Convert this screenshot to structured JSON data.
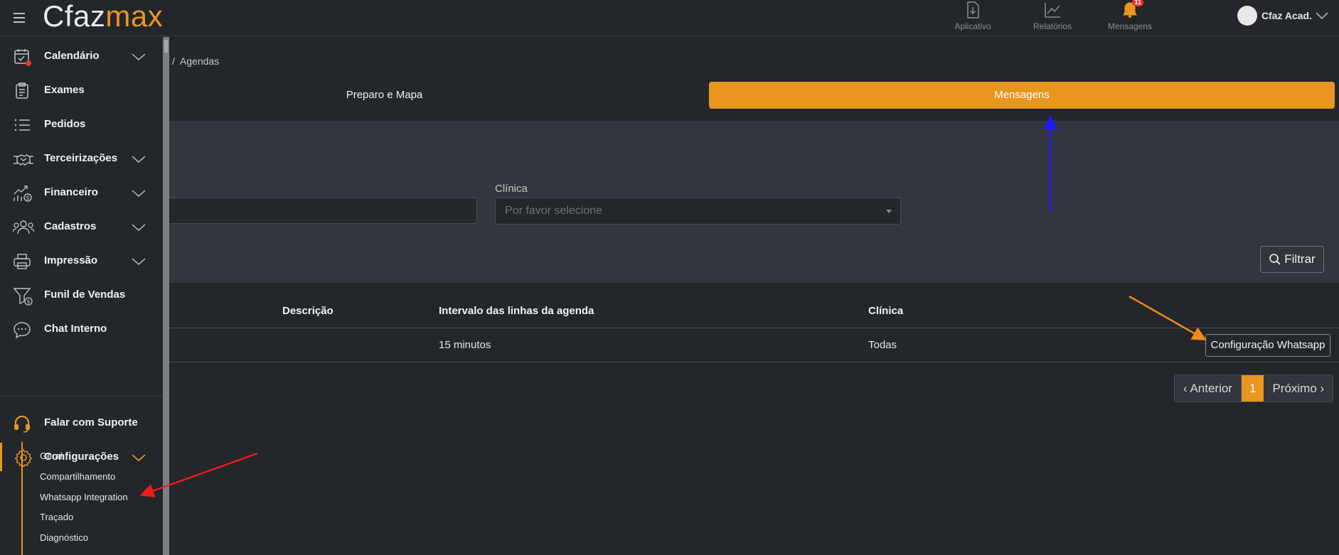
{
  "app": {
    "logo_main": "Cfaz",
    "logo_accent": "max",
    "accent_color": "#e8961f"
  },
  "topnav": [
    {
      "label": "Aplicativo",
      "icon": "download-file-icon"
    },
    {
      "label": "Relatórios",
      "icon": "chart-line-icon"
    },
    {
      "label": "Mensagens",
      "icon": "bell-icon",
      "badge": "11"
    }
  ],
  "user": {
    "name": "Cfaz Acad."
  },
  "sidebar": {
    "items": [
      {
        "label": "Calendário"
      },
      {
        "label": "Exames"
      },
      {
        "label": "Pedidos"
      },
      {
        "label": "Terceirizações"
      },
      {
        "label": "Financeiro"
      },
      {
        "label": "Cadastros"
      },
      {
        "label": "Impressão"
      },
      {
        "label": "Funil de Vendas"
      },
      {
        "label": "Chat Interno"
      },
      {
        "label": "Falar com Suporte"
      },
      {
        "label": "Configurações"
      }
    ],
    "subitems": [
      {
        "label": "Geral"
      },
      {
        "label": "Compartilhamento"
      },
      {
        "label": "Whatsapp Integration"
      },
      {
        "label": "Traçado"
      },
      {
        "label": "Diagnóstico"
      }
    ]
  },
  "breadcrumb": {
    "separator": "/",
    "current": "Agendas"
  },
  "tabs": [
    {
      "label": "Preparo e Mapa"
    },
    {
      "label": "Mensagens"
    }
  ],
  "filters": {
    "clinic_label": "Clínica",
    "clinic_placeholder": "Por favor selecione",
    "filter_button": "Filtrar"
  },
  "table": {
    "headers": [
      "Descrição",
      "Intervalo das linhas da agenda",
      "Clínica"
    ],
    "rows": [
      {
        "interval": "15 minutos",
        "clinic": "Todas",
        "action": "Configuração Whatsapp"
      }
    ]
  },
  "pagination": {
    "prev": "‹ Anterior",
    "current": "1",
    "next": "Próximo ›"
  }
}
